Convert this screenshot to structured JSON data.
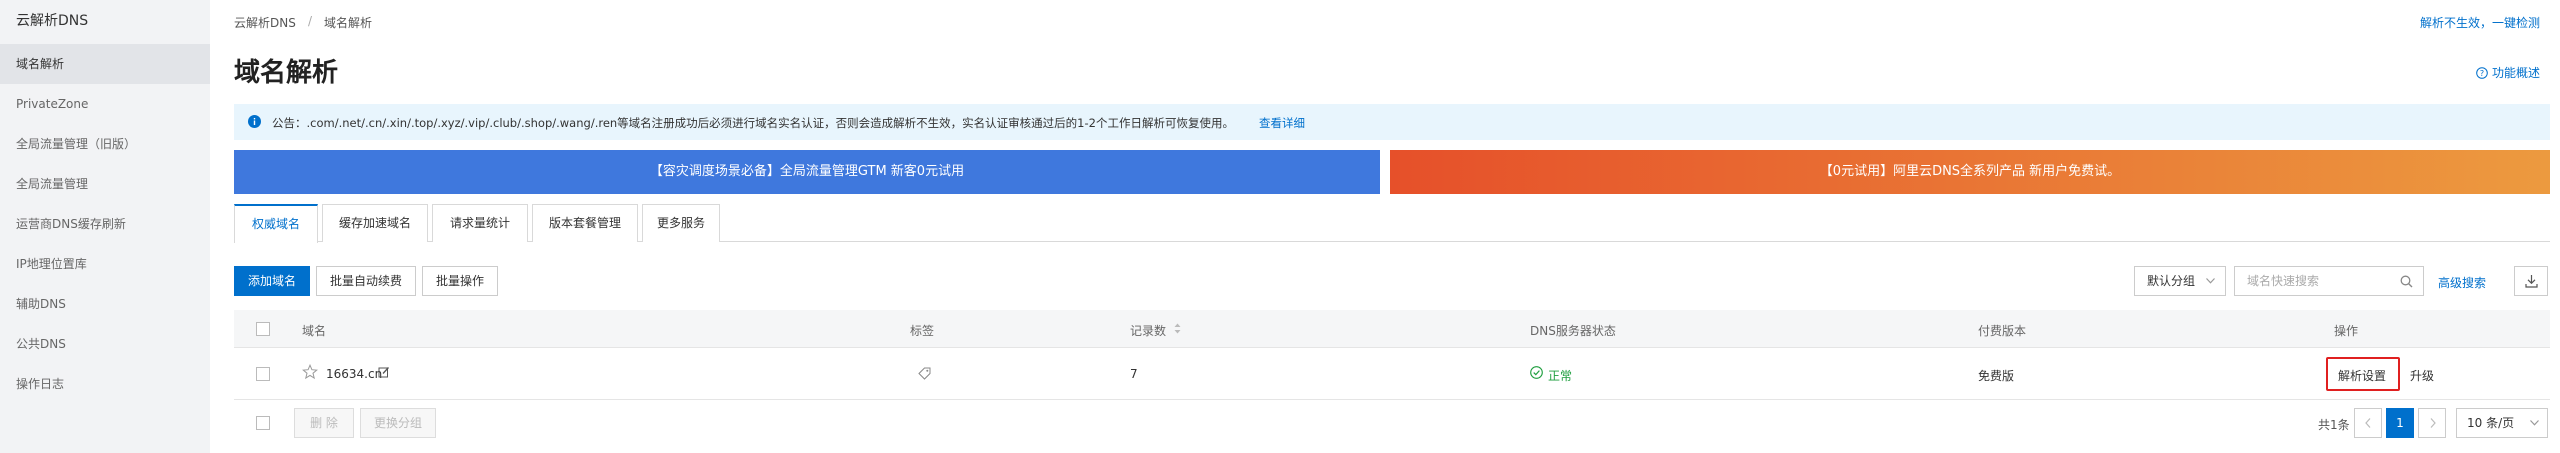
{
  "sidebar": {
    "title": "云解析DNS",
    "items": [
      {
        "label": "域名解析",
        "active": true
      },
      {
        "label": "PrivateZone"
      },
      {
        "label": "全局流量管理（旧版）"
      },
      {
        "label": "全局流量管理"
      },
      {
        "label": "运营商DNS缓存刷新"
      },
      {
        "label": "IP地理位置库"
      },
      {
        "label": "辅助DNS"
      },
      {
        "label": "公共DNS"
      },
      {
        "label": "操作日志"
      }
    ]
  },
  "breadcrumb": {
    "root": "云解析DNS",
    "sep": "/",
    "current": "域名解析"
  },
  "top_right_link": "解析不生效，一键检测",
  "page_title": "域名解析",
  "feature_overview": "功能概述",
  "notice": {
    "text": "公告：.com/.net/.cn/.xin/.top/.xyz/.vip/.club/.shop/.wang/.ren等域名注册成功后必须进行域名实名认证，否则会造成解析不生效，实名认证审核通过后的1-2个工作日解析可恢复使用。",
    "link": "查看详细"
  },
  "banners": [
    {
      "text": "【容灾调度场景必备】全局流量管理GTM 新客0元试用",
      "color": "#3f78dd"
    },
    {
      "text": "【0元试用】阿里云DNS全系列产品 新用户免费试。",
      "color": "#e9622a"
    }
  ],
  "tabs": [
    "权威域名",
    "缓存加速域名",
    "请求量统计",
    "版本套餐管理",
    "更多服务"
  ],
  "toolbar": {
    "add_domain": "添加域名",
    "batch_renew": "批量自动续费",
    "batch_ops": "批量操作",
    "group_select": "默认分组",
    "search_placeholder": "域名快速搜索",
    "advanced_search": "高级搜索"
  },
  "table": {
    "columns": [
      "域名",
      "标签",
      "记录数",
      "DNS服务器状态",
      "付费版本",
      "操作"
    ],
    "rows": [
      {
        "domain": "16634.cn",
        "records": "7",
        "dns_status": "正常",
        "plan": "免费版",
        "action_primary": "解析设置",
        "action_secondary": "升级"
      }
    ]
  },
  "footer": {
    "delete": "删 除",
    "change_group": "更换分组",
    "total": "共1条",
    "page": "1",
    "page_size": "10 条/页"
  },
  "colors": {
    "accent": "#0070cc",
    "success": "#1e9e3e",
    "highlight_border": "#e02020"
  }
}
